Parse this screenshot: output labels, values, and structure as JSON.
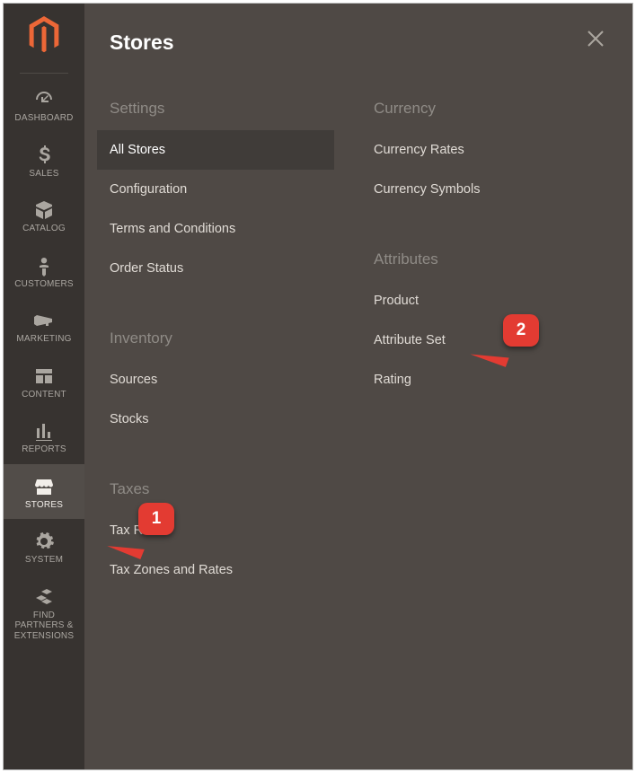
{
  "nav": {
    "items": [
      {
        "id": "dashboard",
        "label": "DASHBOARD",
        "icon": "dashboard"
      },
      {
        "id": "sales",
        "label": "SALES",
        "icon": "dollar"
      },
      {
        "id": "catalog",
        "label": "CATALOG",
        "icon": "box"
      },
      {
        "id": "customers",
        "label": "CUSTOMERS",
        "icon": "person"
      },
      {
        "id": "marketing",
        "label": "MARKETING",
        "icon": "megaphone"
      },
      {
        "id": "content",
        "label": "CONTENT",
        "icon": "layout"
      },
      {
        "id": "reports",
        "label": "REPORTS",
        "icon": "barchart"
      },
      {
        "id": "stores",
        "label": "STORES",
        "icon": "storefront",
        "active": true
      },
      {
        "id": "system",
        "label": "SYSTEM",
        "icon": "gear"
      },
      {
        "id": "partners",
        "label": "FIND PARTNERS & EXTENSIONS",
        "icon": "blocks"
      }
    ]
  },
  "panel": {
    "title": "Stores",
    "columns": [
      {
        "groups": [
          {
            "heading": "Settings",
            "items": [
              {
                "label": "All Stores",
                "hover": true
              },
              {
                "label": "Configuration"
              },
              {
                "label": "Terms and Conditions"
              },
              {
                "label": "Order Status"
              }
            ]
          },
          {
            "heading": "Inventory",
            "items": [
              {
                "label": "Sources"
              },
              {
                "label": "Stocks"
              }
            ]
          },
          {
            "heading": "Taxes",
            "items": [
              {
                "label": "Tax Rules"
              },
              {
                "label": "Tax Zones and Rates"
              }
            ]
          }
        ]
      },
      {
        "groups": [
          {
            "heading": "Currency",
            "items": [
              {
                "label": "Currency Rates"
              },
              {
                "label": "Currency Symbols"
              }
            ]
          },
          {
            "heading": "Attributes",
            "items": [
              {
                "label": "Product"
              },
              {
                "label": "Attribute Set"
              },
              {
                "label": "Rating"
              }
            ]
          }
        ]
      }
    ]
  },
  "annotations": {
    "1": "1",
    "2": "2"
  }
}
